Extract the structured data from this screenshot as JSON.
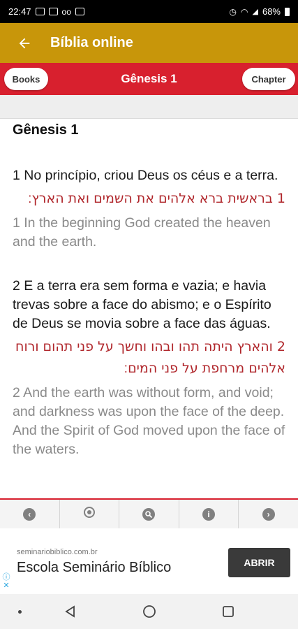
{
  "status_bar": {
    "time": "22:47",
    "battery": "68%"
  },
  "app_bar": {
    "title": "Bíblia online",
    "back_icon": "arrow-left-icon"
  },
  "book_bar": {
    "books_label": "Books",
    "title": "Gênesis 1",
    "chapter_label": "Chapter"
  },
  "content": {
    "heading": "Gênesis 1",
    "verses": [
      {
        "pt": "1 No princípio, criou Deus os céus e a terra.",
        "he": "1 בראשית ברא אלהים את השמים ואת הארץ׃",
        "en": "1 In the beginning God created the heaven and the earth."
      },
      {
        "pt": "2 E a terra era sem forma e vazia; e havia trevas sobre a face do abismo; e o Espírito de Deus se movia sobre a face das águas.",
        "he": "2 והארץ היתה תהו ובהו וחשך על פני תהום ורוח אלהים מרחפת על פני המים׃",
        "en": "2 And the earth was without form, and void; and darkness was upon the face of the deep. And the Spirit of God moved upon the face of the waters."
      }
    ]
  },
  "toolbar": {
    "icons": [
      "previous-icon",
      "settings-icon",
      "search-icon",
      "info-icon",
      "next-icon"
    ]
  },
  "ad": {
    "domain": "seminariobiblico.com.br",
    "title": "Escola Seminário Bíblico",
    "button": "ABRIR"
  },
  "colors": {
    "app_bar": "#c8960a",
    "book_bar": "#d8202e",
    "hebrew_text": "#b0262b",
    "english_text": "#8a8a8a"
  }
}
